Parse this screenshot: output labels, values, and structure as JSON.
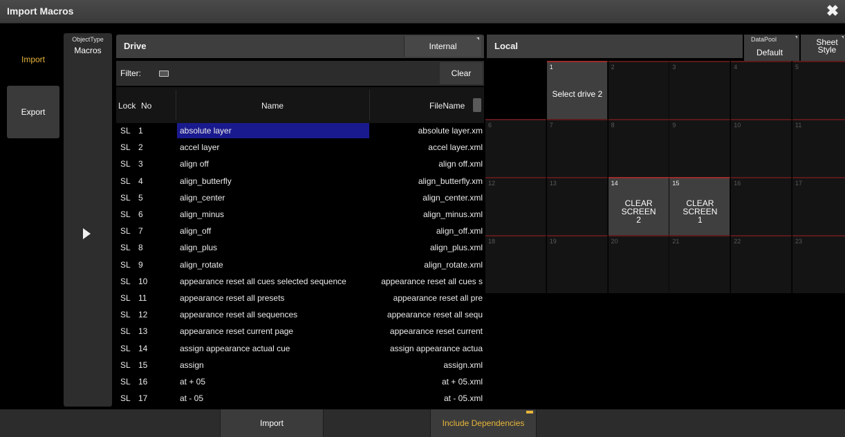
{
  "window": {
    "title": "Import Macros"
  },
  "tabs": {
    "import": "Import",
    "export": "Export"
  },
  "object_type": {
    "label": "ObjectType",
    "value": "Macros"
  },
  "drive": {
    "title": "Drive",
    "selector": "Internal"
  },
  "filter": {
    "label": "Filter:",
    "value": "",
    "clear": "Clear"
  },
  "table": {
    "headers": {
      "lock": "Lock",
      "no": "No",
      "name": "Name",
      "filename": "FileName"
    },
    "rows": [
      {
        "lock": "SL",
        "no": "1",
        "name": "absolute layer",
        "file": "absolute layer.xm"
      },
      {
        "lock": "SL",
        "no": "2",
        "name": "accel layer",
        "file": "accel layer.xml"
      },
      {
        "lock": "SL",
        "no": "3",
        "name": "align off",
        "file": "align off.xml"
      },
      {
        "lock": "SL",
        "no": "4",
        "name": "align_butterfly",
        "file": "align_butterfly.xm"
      },
      {
        "lock": "SL",
        "no": "5",
        "name": "align_center",
        "file": "align_center.xml"
      },
      {
        "lock": "SL",
        "no": "6",
        "name": "align_minus",
        "file": "align_minus.xml"
      },
      {
        "lock": "SL",
        "no": "7",
        "name": "align_off",
        "file": "align_off.xml"
      },
      {
        "lock": "SL",
        "no": "8",
        "name": "align_plus",
        "file": "align_plus.xml"
      },
      {
        "lock": "SL",
        "no": "9",
        "name": "align_rotate",
        "file": "align_rotate.xml"
      },
      {
        "lock": "SL",
        "no": "10",
        "name": "appearance reset all cues selected sequence",
        "file": "appearance reset all cues s"
      },
      {
        "lock": "SL",
        "no": "11",
        "name": "appearance reset all presets",
        "file": "appearance reset all pre"
      },
      {
        "lock": "SL",
        "no": "12",
        "name": "appearance reset all sequences",
        "file": "appearance reset all sequ"
      },
      {
        "lock": "SL",
        "no": "13",
        "name": "appearance reset current page",
        "file": "appearance reset current"
      },
      {
        "lock": "SL",
        "no": "14",
        "name": "assign appearance actual cue",
        "file": "assign appearance actua"
      },
      {
        "lock": "SL",
        "no": "15",
        "name": "assign",
        "file": "assign.xml"
      },
      {
        "lock": "SL",
        "no": "16",
        "name": "at + 05",
        "file": "at + 05.xml"
      },
      {
        "lock": "SL",
        "no": "17",
        "name": "at - 05",
        "file": "at - 05.xml"
      }
    ]
  },
  "local": {
    "title": "Local",
    "datapool_label": "DataPool",
    "datapool_value": "Default",
    "sheet_style": "Sheet Style",
    "cells": [
      {
        "n": "1",
        "label": "Select drive 2"
      },
      {
        "n": "2",
        "label": ""
      },
      {
        "n": "3",
        "label": ""
      },
      {
        "n": "4",
        "label": ""
      },
      {
        "n": "5",
        "label": ""
      },
      {
        "n": "6",
        "label": ""
      },
      {
        "n": "7",
        "label": ""
      },
      {
        "n": "8",
        "label": ""
      },
      {
        "n": "9",
        "label": ""
      },
      {
        "n": "10",
        "label": ""
      },
      {
        "n": "11",
        "label": ""
      },
      {
        "n": "12",
        "label": ""
      },
      {
        "n": "13",
        "label": ""
      },
      {
        "n": "14",
        "label": "CLEAR SCREEN 2"
      },
      {
        "n": "15",
        "label": "CLEAR SCREEN 1"
      },
      {
        "n": "16",
        "label": ""
      },
      {
        "n": "17",
        "label": ""
      },
      {
        "n": "18",
        "label": ""
      },
      {
        "n": "19",
        "label": ""
      },
      {
        "n": "20",
        "label": ""
      },
      {
        "n": "21",
        "label": ""
      },
      {
        "n": "22",
        "label": ""
      },
      {
        "n": "23",
        "label": ""
      }
    ]
  },
  "footer": {
    "import": "Import",
    "include_dependencies": "Include Dependencies"
  },
  "colors": {
    "accent": "#e8b63a",
    "selection": "#1a1a8f",
    "pool_top": "#9d2c2c"
  }
}
